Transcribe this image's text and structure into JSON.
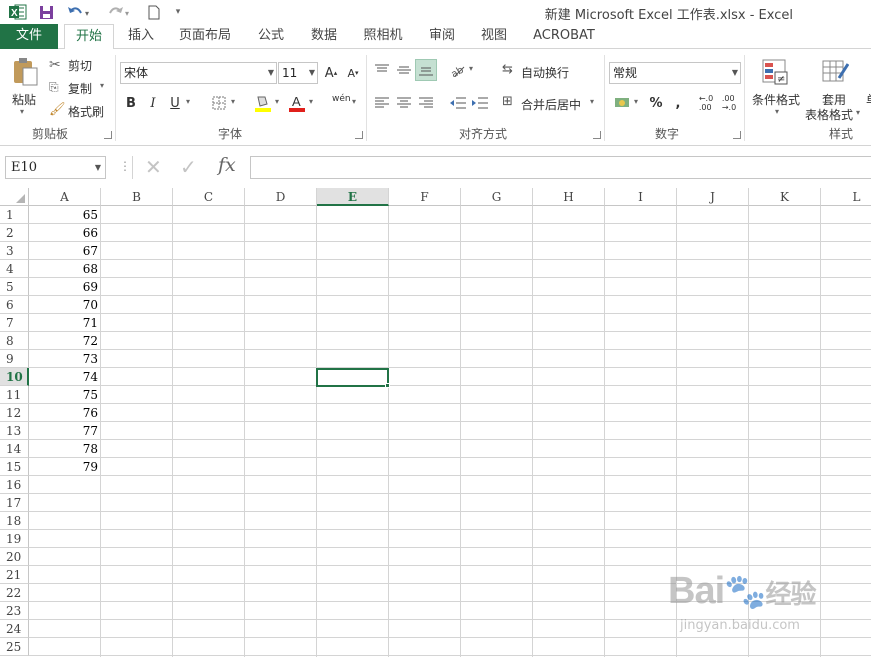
{
  "title_bar": {
    "title": "新建 Microsoft Excel 工作表.xlsx - Excel"
  },
  "tabs": {
    "file": "文件",
    "items": [
      "开始",
      "插入",
      "页面布局",
      "公式",
      "数据",
      "照相机",
      "审阅",
      "视图",
      "ACROBAT"
    ],
    "active_index": 0
  },
  "ribbon": {
    "clipboard": {
      "paste": "粘贴",
      "cut": "剪切",
      "copy": "复制",
      "format_painter": "格式刷",
      "label": "剪贴板"
    },
    "font": {
      "name": "宋体",
      "size": "11",
      "bold": "B",
      "italic": "I",
      "underline": "U",
      "phonetic": "wén",
      "label": "字体"
    },
    "alignment": {
      "wrap": "自动换行",
      "merge": "合并后居中",
      "label": "对齐方式"
    },
    "number": {
      "format": "常规",
      "label": "数字"
    },
    "styles": {
      "conditional": "条件格式",
      "table_line1": "套用",
      "table_line2": "表格格式",
      "label": "样式"
    }
  },
  "formula_bar": {
    "name_box": "E10",
    "formula": ""
  },
  "sheet": {
    "columns": [
      "A",
      "B",
      "C",
      "D",
      "E",
      "F",
      "G",
      "H",
      "I",
      "J",
      "K",
      "L"
    ],
    "selected_column": "E",
    "rows": [
      "1",
      "2",
      "3",
      "4",
      "5",
      "6",
      "7",
      "8",
      "9",
      "10",
      "11",
      "12",
      "13",
      "14",
      "15",
      "16",
      "17",
      "18",
      "19",
      "20",
      "21",
      "22",
      "23",
      "24",
      "25"
    ],
    "selected_row": "10",
    "column_a_values": [
      "65",
      "66",
      "67",
      "68",
      "69",
      "70",
      "71",
      "72",
      "73",
      "74",
      "75",
      "76",
      "77",
      "78",
      "79"
    ]
  },
  "watermark": {
    "brand": "Bai",
    "brand2": "经验",
    "url": "jingyan.baidu.com"
  },
  "colors": {
    "accent": "#217346",
    "gridline": "#d4d4d4"
  }
}
